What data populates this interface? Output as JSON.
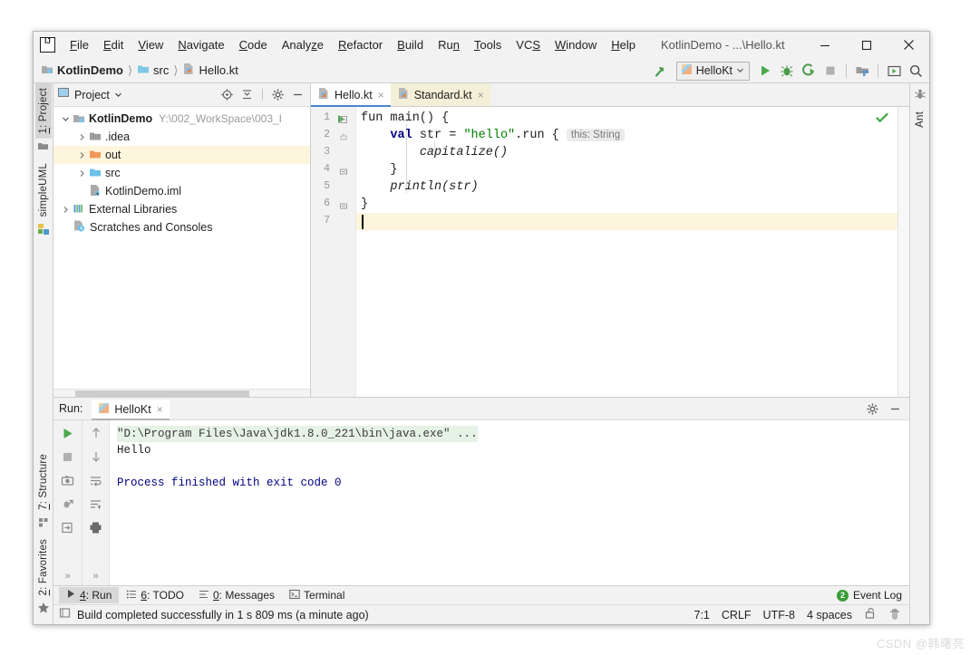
{
  "window": {
    "title": "KotlinDemo - ...\\Hello.kt",
    "logo": "intellij-idea-logo",
    "minimize": "minimize-icon",
    "maximize": "maximize-icon",
    "close": "close-icon"
  },
  "menu": [
    {
      "label": "File",
      "mnemonic": "F"
    },
    {
      "label": "Edit",
      "mnemonic": "E"
    },
    {
      "label": "View",
      "mnemonic": "V"
    },
    {
      "label": "Navigate",
      "mnemonic": "N"
    },
    {
      "label": "Code",
      "mnemonic": "C"
    },
    {
      "label": "Analyze",
      "mnemonic": "z"
    },
    {
      "label": "Refactor",
      "mnemonic": "R"
    },
    {
      "label": "Build",
      "mnemonic": "B"
    },
    {
      "label": "Run",
      "mnemonic": "n"
    },
    {
      "label": "Tools",
      "mnemonic": "T"
    },
    {
      "label": "VCS",
      "mnemonic": "S"
    },
    {
      "label": "Window",
      "mnemonic": "W"
    },
    {
      "label": "Help",
      "mnemonic": "H"
    }
  ],
  "breadcrumb": [
    {
      "label": "KotlinDemo",
      "icon": "module-icon",
      "bold": true
    },
    {
      "label": "src",
      "icon": "folder-icon",
      "bold": false
    },
    {
      "label": "Hello.kt",
      "icon": "kotlin-file-icon",
      "bold": false
    }
  ],
  "toolbar": {
    "build_icon": "hammer-icon",
    "run_config": "HelloKt",
    "run_config_icon": "kotlin-icon",
    "run_icon": "run-icon",
    "debug_icon": "debug-icon",
    "coverage_icon": "run-with-coverage-icon",
    "stop_icon": "stop-icon",
    "structure_icon": "project-structure-icon",
    "update_icon": "update-project-icon",
    "search_icon": "search-everywhere-icon"
  },
  "left_strip": [
    {
      "label": "1: Project",
      "mnemonic": "1",
      "active": true,
      "icon": "project-icon"
    },
    {
      "label": "simpleUML",
      "mnemonic": "",
      "active": false,
      "icon": "uml-icon"
    },
    {
      "label": "7: Structure",
      "mnemonic": "7",
      "active": false,
      "icon": "structure-icon"
    },
    {
      "label": "2: Favorites",
      "mnemonic": "2",
      "active": false,
      "icon": "favorites-star-icon"
    }
  ],
  "right_strip": [
    {
      "label": "Ant",
      "icon": "ant-icon"
    }
  ],
  "project_panel": {
    "title": "Project",
    "dropdown_icon": "chevron-down-icon",
    "view_icon": "project-view-icon",
    "actions": [
      {
        "name": "locate-icon"
      },
      {
        "name": "collapse-all-icon"
      },
      {
        "name": "gear-icon"
      },
      {
        "name": "hide-icon"
      }
    ],
    "tree": [
      {
        "label": "KotlinDemo",
        "path": "Y:\\002_WorkSpace\\003_I",
        "depth": 0,
        "arrow": "expanded",
        "icon": "module-icon",
        "bold": true,
        "highlighted": false
      },
      {
        "label": ".idea",
        "path": "",
        "depth": 1,
        "arrow": "collapsed",
        "icon": "folder-icon",
        "bold": false,
        "highlighted": false
      },
      {
        "label": "out",
        "path": "",
        "depth": 1,
        "arrow": "collapsed",
        "icon": "folder-orange-icon",
        "bold": false,
        "highlighted": true
      },
      {
        "label": "src",
        "path": "",
        "depth": 1,
        "arrow": "collapsed",
        "icon": "folder-blue-icon",
        "bold": false,
        "highlighted": false
      },
      {
        "label": "KotlinDemo.iml",
        "path": "",
        "depth": 1,
        "arrow": "none",
        "icon": "iml-file-icon",
        "bold": false,
        "highlighted": false
      },
      {
        "label": "External Libraries",
        "path": "",
        "depth": 0,
        "arrow": "collapsed",
        "icon": "libraries-icon",
        "bold": false,
        "highlighted": false
      },
      {
        "label": "Scratches and Consoles",
        "path": "",
        "depth": 0,
        "arrow": "none",
        "icon": "scratches-icon",
        "bold": false,
        "highlighted": false
      }
    ]
  },
  "editor": {
    "tabs": [
      {
        "label": "Hello.kt",
        "icon": "kotlin-file-icon",
        "active": true,
        "close": "×"
      },
      {
        "label": "Standard.kt",
        "icon": "kotlin-file-icon",
        "active": false,
        "close": "×"
      }
    ],
    "line_numbers": [
      "1",
      "2",
      "3",
      "4",
      "5",
      "6",
      "7"
    ],
    "inspection_status": "checkmark-ok-icon",
    "code": [
      {
        "no": "1",
        "segments": [
          {
            "t": "fun main() {",
            "c": "plain"
          }
        ]
      },
      {
        "no": "2",
        "segments": [
          {
            "t": "    ",
            "c": "plain"
          },
          {
            "t": "val",
            "c": "kw"
          },
          {
            "t": " str = ",
            "c": "plain"
          },
          {
            "t": "\"hello\"",
            "c": "str"
          },
          {
            "t": ".run { ",
            "c": "plain"
          },
          {
            "t": "this: String",
            "c": "inlay"
          }
        ]
      },
      {
        "no": "3",
        "segments": [
          {
            "t": "        ",
            "c": "plain"
          },
          {
            "t": "capitalize()",
            "c": "fn"
          }
        ]
      },
      {
        "no": "4",
        "segments": [
          {
            "t": "    }",
            "c": "plain"
          }
        ]
      },
      {
        "no": "5",
        "segments": [
          {
            "t": "    ",
            "c": "plain"
          },
          {
            "t": "println(str)",
            "c": "fn"
          }
        ]
      },
      {
        "no": "6",
        "segments": [
          {
            "t": "}",
            "c": "plain"
          }
        ]
      },
      {
        "no": "7",
        "segments": [
          {
            "t": "",
            "c": "plain"
          }
        ]
      }
    ]
  },
  "run_window": {
    "label": "Run:",
    "tab": "HelloKt",
    "tab_icon": "kotlin-icon",
    "tab_close": "×",
    "settings_icon": "gear-icon",
    "hide_icon": "hide-icon",
    "left_tools": [
      {
        "name": "rerun-icon"
      },
      {
        "name": "stop-icon"
      },
      {
        "name": "snapshot-icon"
      },
      {
        "name": "debug-attach-icon"
      },
      {
        "name": "export-icon"
      },
      {
        "name": "overflow-icon",
        "label": "»"
      }
    ],
    "second_tools": [
      {
        "name": "up-arrow-icon"
      },
      {
        "name": "down-arrow-icon"
      },
      {
        "name": "soft-wrap-icon"
      },
      {
        "name": "sort-icon"
      },
      {
        "name": "print-icon"
      },
      {
        "name": "overflow-icon",
        "label": "»"
      }
    ],
    "console": [
      {
        "text": "\"D:\\Program Files\\Java\\jdk1.8.0_221\\bin\\java.exe\" ...",
        "style": "cmd"
      },
      {
        "text": "Hello",
        "style": "plain"
      },
      {
        "text": "",
        "style": "plain"
      },
      {
        "text": "Process finished with exit code 0",
        "style": "exit"
      }
    ]
  },
  "bottom_bar": {
    "items": [
      {
        "label": "4: Run",
        "mnemonic": "4",
        "icon": "run-icon",
        "active": true
      },
      {
        "label": "6: TODO",
        "mnemonic": "6",
        "icon": "todo-icon",
        "active": false
      },
      {
        "label": "0: Messages",
        "mnemonic": "0",
        "icon": "messages-icon",
        "active": false
      },
      {
        "label": "Terminal",
        "mnemonic": "",
        "icon": "terminal-icon",
        "active": false
      }
    ],
    "event_log": {
      "label": "Event Log",
      "count": "2"
    }
  },
  "status_bar": {
    "icon": "status-toggle-icon",
    "message": "Build completed successfully in 1 s 809 ms (a minute ago)",
    "caret": "7:1",
    "line_sep": "CRLF",
    "encoding": "UTF-8",
    "indent": "4 spaces",
    "lock_icon": "unlocked-icon",
    "inspection_icon": "hector-icon"
  },
  "watermark": "CSDN @韩曙亮"
}
